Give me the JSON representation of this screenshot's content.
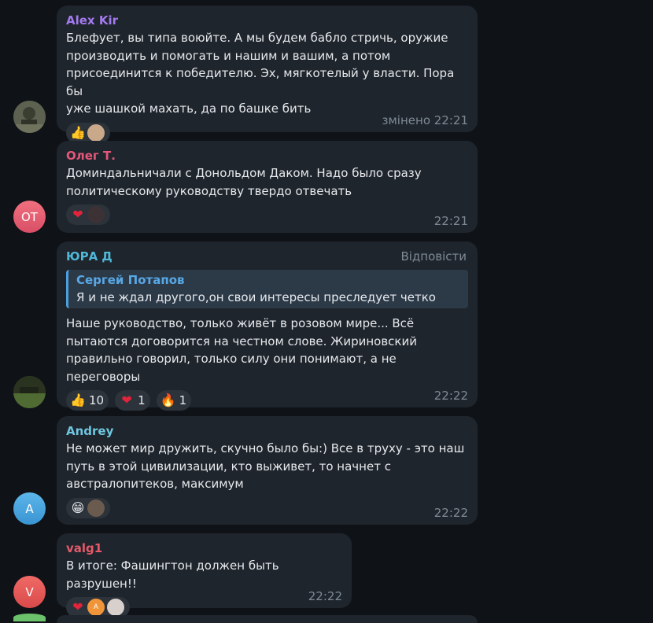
{
  "messages": [
    {
      "sender": "Alex Kir",
      "sender_color": "#a47af0",
      "text": "Блефует, вы типа воюйте. А мы будем бабло стричь, оружие\nпроизводить и помогать и нашим и вашим, а потом\nприсоединится к победителю. Эх, мягкотелый у власти. Пора бы\nуже шашкой махать, да по башке бить",
      "time": "змінено 22:21",
      "reaction_emoji": "👍"
    },
    {
      "sender": "Олег Т.",
      "sender_color": "#e4567a",
      "avatar_initials": "ОТ",
      "text": "Доминдальничали с Донольдом Даком. Надо было сразу\nполитическому руководству твердо отвечать",
      "time": "22:21",
      "reaction_emoji": "❤"
    },
    {
      "sender": "ЮРА Д",
      "sender_color": "#4fb8d8",
      "reply_label": "Відповісти",
      "quote_name": "Сергей Потапов",
      "quote_text": "Я и не ждал другого,он свои интересы преследует четко",
      "text": "Наше руководство, только живёт в розовом мире... Всё\nпытаются договорится на честном слове. Жириновский\nправильно говорил, только силу они понимают, а не\nпереговоры",
      "time": "22:22",
      "reactions": [
        {
          "emoji": "👍",
          "count": "10"
        },
        {
          "emoji": "❤",
          "count": "1"
        },
        {
          "emoji": "🔥",
          "count": "1"
        }
      ]
    },
    {
      "sender": "Andrey",
      "sender_color": "#6ec6e0",
      "avatar_initials": "A",
      "text": "Не может мир дружить, скучно было бы:)  Все в труху - это наш\nпуть в этой цивилизации, кто выживет, то начнет с\nавстралопитеков, максимум",
      "time": "22:22",
      "reaction_emoji": "😁"
    },
    {
      "sender": "valg1",
      "sender_color": "#e45a6a",
      "avatar_initials": "V",
      "text": "В итоге: Фашингтон должен быть разрушен!!",
      "time": "22:22",
      "reaction_emoji": "❤",
      "reaction_avatar_initial": "A"
    }
  ]
}
